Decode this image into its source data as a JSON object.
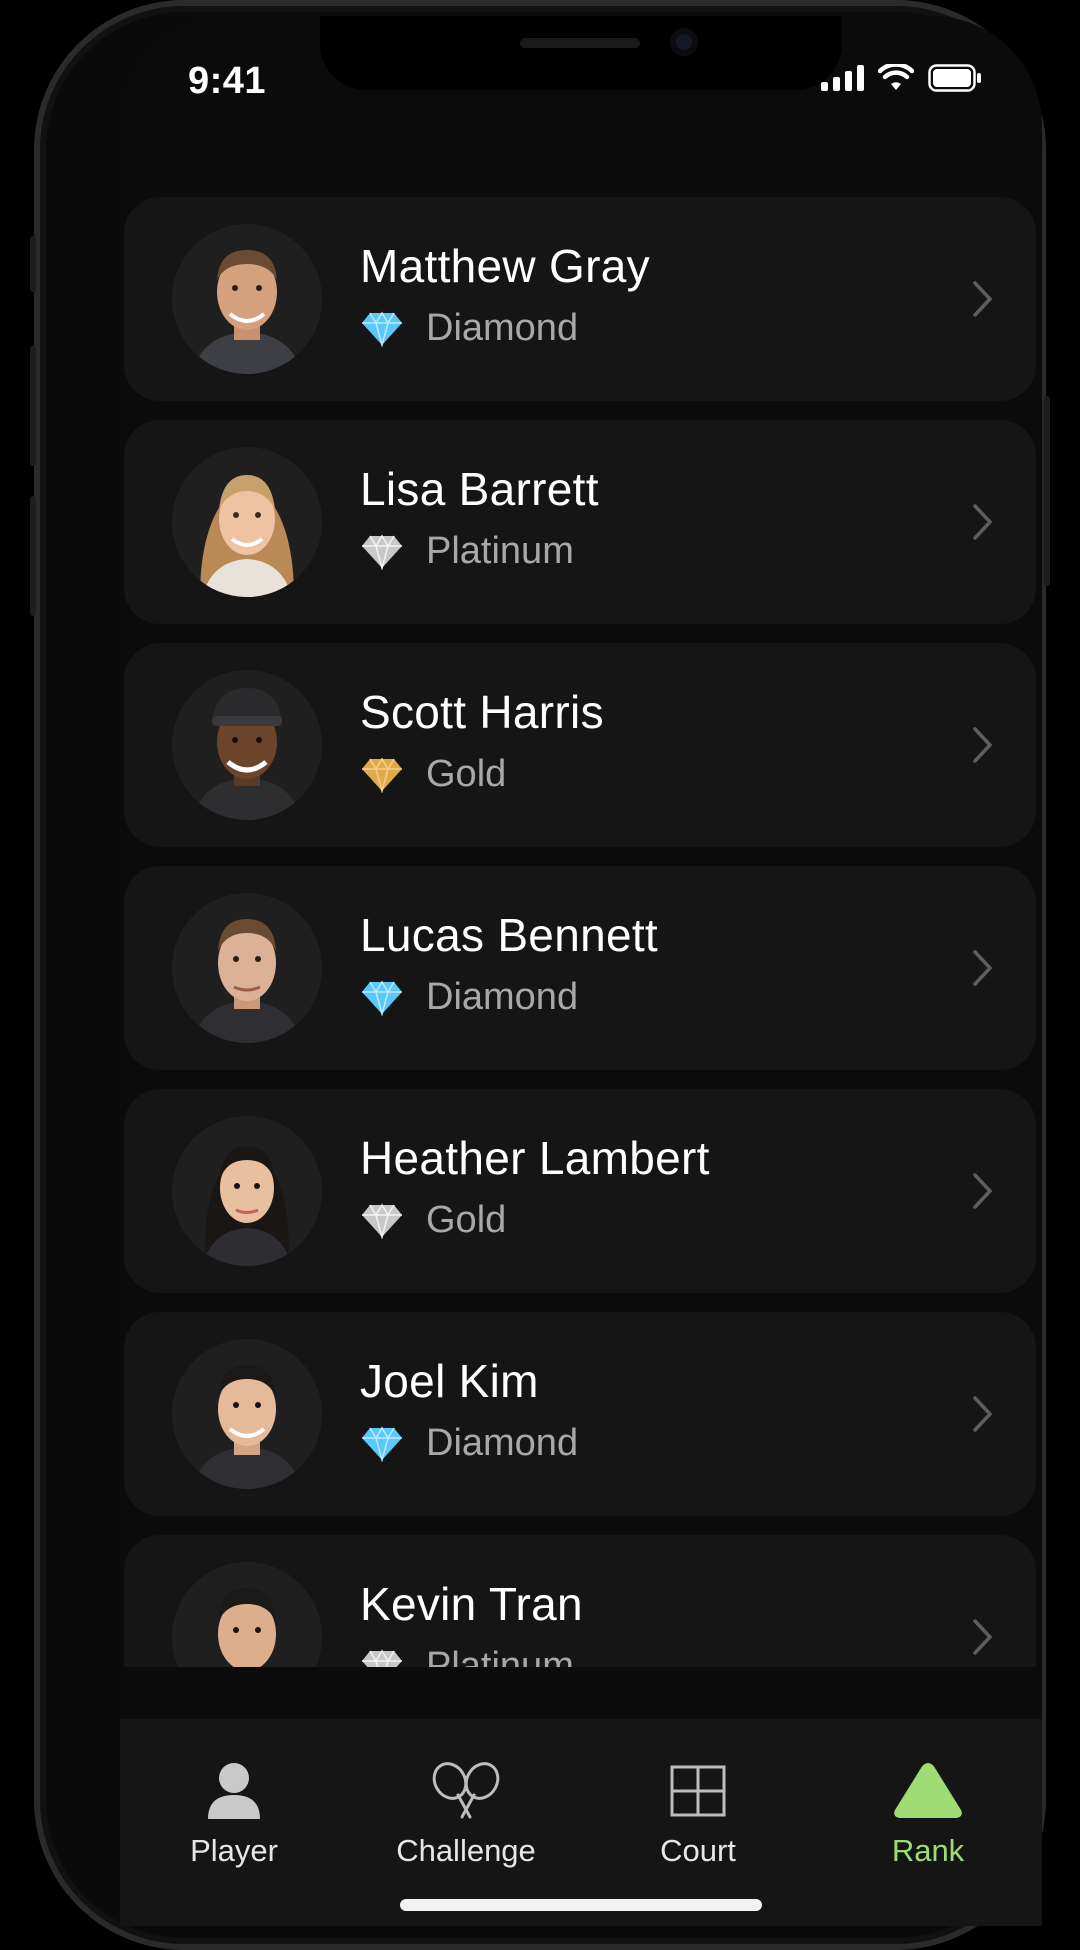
{
  "status_bar": {
    "time": "9:41",
    "icons": [
      "signal-icon",
      "wifi-icon",
      "battery-icon"
    ]
  },
  "players": [
    {
      "name": "Matthew Gray",
      "tier": "Diamond",
      "tier_icon": "diamond-blue-icon",
      "tier_color": "#5ac8fa"
    },
    {
      "name": "Lisa Barrett",
      "tier": "Platinum",
      "tier_icon": "diamond-silver-icon",
      "tier_color": "#c8c8c8"
    },
    {
      "name": "Scott Harris",
      "tier": "Gold",
      "tier_icon": "diamond-gold-icon",
      "tier_color": "#e0a94a"
    },
    {
      "name": "Lucas Bennett",
      "tier": "Diamond",
      "tier_icon": "diamond-blue-icon",
      "tier_color": "#5ac8fa"
    },
    {
      "name": "Heather Lambert",
      "tier": "Gold",
      "tier_icon": "diamond-silver-icon",
      "tier_color": "#c8c8c8"
    },
    {
      "name": "Joel Kim",
      "tier": "Diamond",
      "tier_icon": "diamond-blue-icon",
      "tier_color": "#5ac8fa"
    },
    {
      "name": "Kevin Tran",
      "tier": "Platinum",
      "tier_icon": "diamond-silver-icon",
      "tier_color": "#c8c8c8"
    }
  ],
  "tabbar": {
    "tabs": [
      {
        "label": "Player",
        "icon": "person-icon",
        "active": false
      },
      {
        "label": "Challenge",
        "icon": "rackets-icon",
        "active": false
      },
      {
        "label": "Court",
        "icon": "grid-icon",
        "active": false
      },
      {
        "label": "Rank",
        "icon": "triangle-icon",
        "active": true
      }
    ],
    "accent_color": "#9fdc74"
  }
}
